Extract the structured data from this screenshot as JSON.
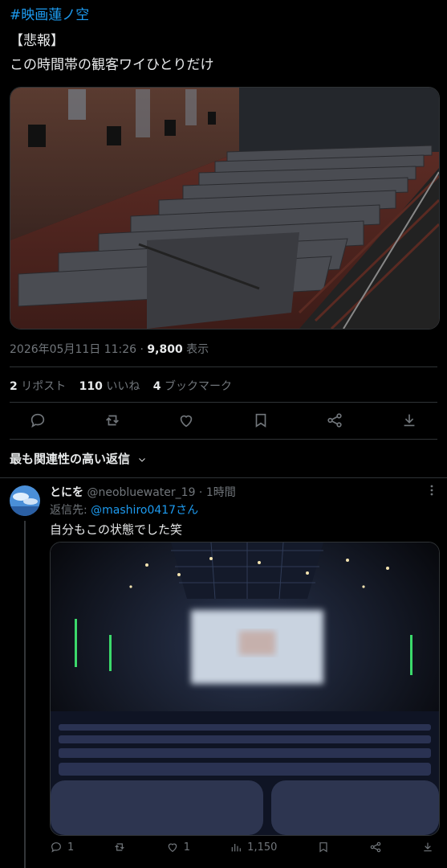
{
  "tweet": {
    "hashtag": "#映画蓮ノ空",
    "line1": "【悲報】",
    "line2": "この時間帯の観客ワイひとりだけ",
    "datetime": "2026年05月11日 11:26 · ",
    "views": "9,800",
    "views_label": " 表示",
    "reposts_count": "2",
    "reposts_label": " リポスト",
    "likes_count": "110",
    "likes_label": " いいね",
    "bookmarks_count": "4",
    "bookmarks_label": " ブックマーク"
  },
  "sort_label": "最も関連性の高い返信",
  "reply": {
    "name": "とにを",
    "handle": "@neobluewater_19",
    "time": " · 1時間",
    "reply_to_label": "返信先: ",
    "reply_to_mention": "@mashiro0417さん",
    "text": "自分もこの状態でした笑",
    "replies": "1",
    "likes": "1",
    "views": "1,150"
  },
  "icons": [
    "reply-icon",
    "repost-icon",
    "like-icon",
    "bookmark-icon",
    "share-icon",
    "download-icon",
    "views-icon",
    "more-icon",
    "chevron-down-icon"
  ],
  "colors": {
    "accent": "#1d9bf0",
    "muted": "#71767b",
    "text": "#e7e9ea",
    "background": "#000000"
  }
}
